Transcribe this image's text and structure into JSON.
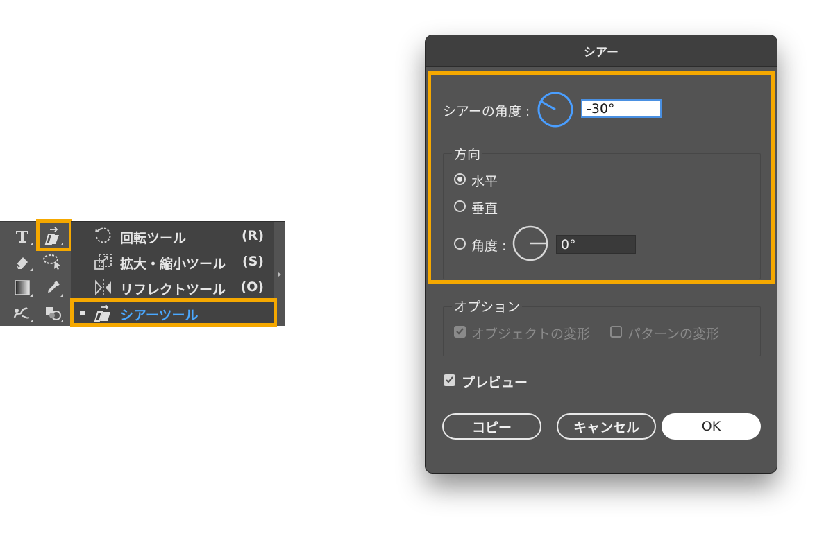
{
  "toolbar": {
    "tools": [
      "type-tool",
      "shear-tool",
      "eraser-tool",
      "lasso-tool",
      "gradient-tool",
      "eyedropper-tool",
      "blend-tool",
      "shape-builder-tool"
    ]
  },
  "flyout": {
    "items": [
      {
        "label": "回転ツール",
        "key": "(R)"
      },
      {
        "label": "拡大・縮小ツール",
        "key": "(S)"
      },
      {
        "label": "リフレクトツール",
        "key": "(O)"
      },
      {
        "label": "シアーツール",
        "key": ""
      }
    ]
  },
  "dialog": {
    "title": "シアー",
    "shear_angle_label": "シアーの角度 :",
    "shear_angle_value": "-30°",
    "direction_label": "方向",
    "horizontal_label": "水平",
    "vertical_label": "垂直",
    "angle_label": "角度 :",
    "angle_value": "0°",
    "options_label": "オプション",
    "transform_objects_label": "オブジェクトの変形",
    "transform_patterns_label": "パターンの変形",
    "preview_label": "プレビュー",
    "copy_button": "コピー",
    "cancel_button": "キャンセル",
    "ok_button": "OK"
  },
  "colors": {
    "highlight": "#f5a800",
    "selected_text": "#4aa8ff",
    "dial_active": "#4a9eff"
  }
}
